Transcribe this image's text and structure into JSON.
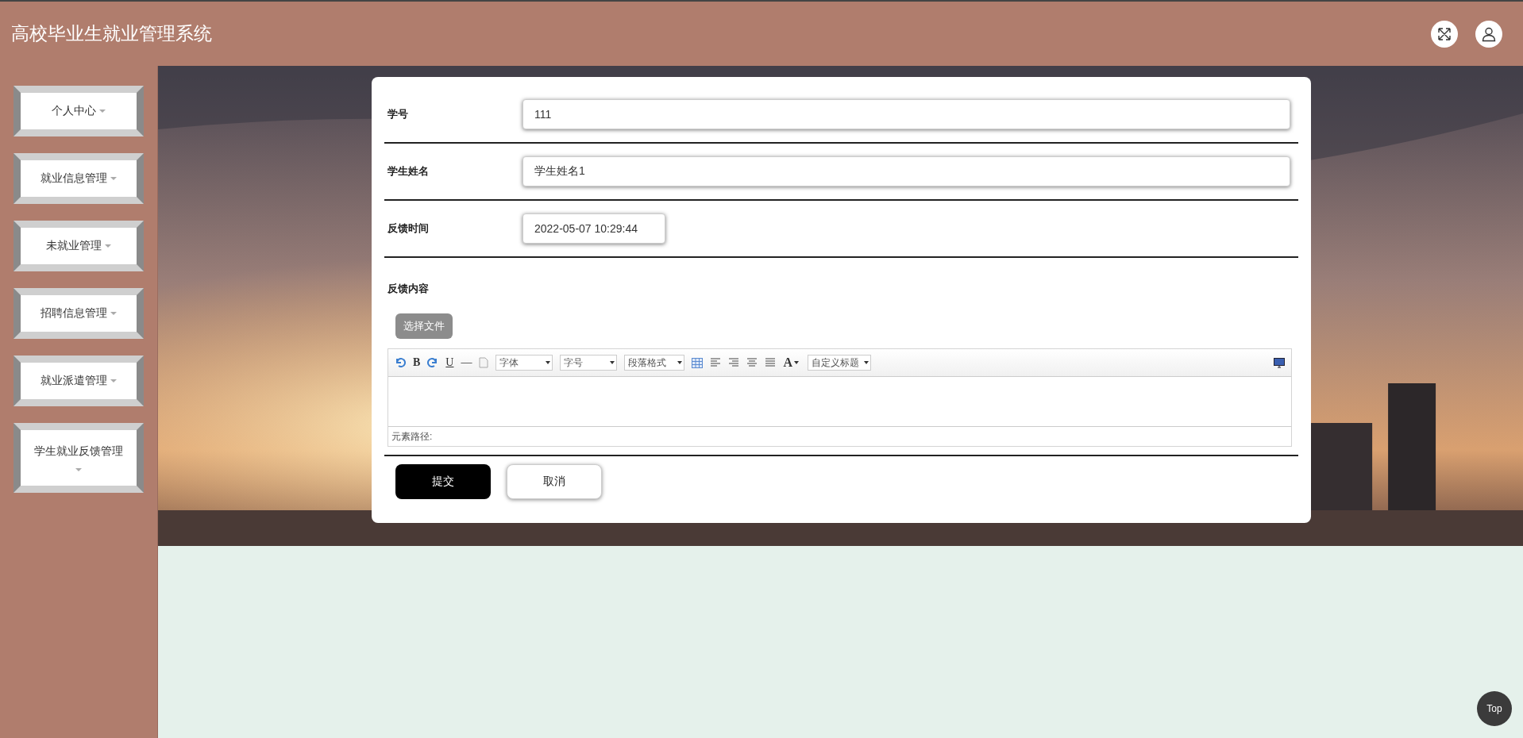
{
  "header": {
    "title": "高校毕业生就业管理系统"
  },
  "sidebar": {
    "items": [
      {
        "label": "个人中心"
      },
      {
        "label": "就业信息管理"
      },
      {
        "label": "未就业管理"
      },
      {
        "label": "招聘信息管理"
      },
      {
        "label": "就业派遣管理"
      },
      {
        "label": "学生就业反馈管理"
      }
    ]
  },
  "form": {
    "fields": [
      {
        "label": "学号",
        "value": "111",
        "kind": "wide"
      },
      {
        "label": "学生姓名",
        "value": "学生姓名1",
        "kind": "wide"
      },
      {
        "label": "反馈时间",
        "value": "2022-05-07 10:29:44",
        "kind": "narrow"
      }
    ],
    "content": {
      "label": "反馈内容",
      "upload_button": "选择文件",
      "toolbar": {
        "bold": "B",
        "underline": "U",
        "rule": "—",
        "dropdowns": [
          "字体",
          "字号",
          "段落格式"
        ],
        "font_color": "A",
        "heading": "自定义标题"
      },
      "path_label": "元素路径:"
    },
    "buttons": {
      "submit": "提交",
      "cancel": "取消"
    }
  },
  "top_button": "Top"
}
